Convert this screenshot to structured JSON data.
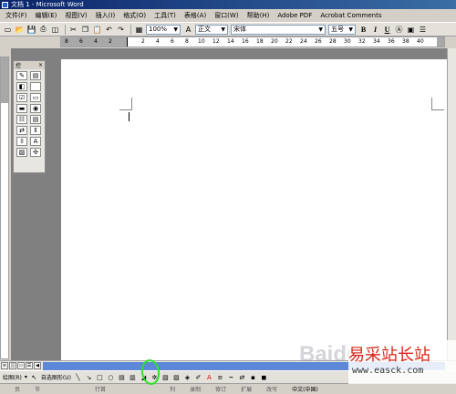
{
  "window": {
    "title": "文档 1 - Microsoft Word"
  },
  "menu": [
    "文件(F)",
    "编辑(E)",
    "视图(V)",
    "插入(I)",
    "格式(O)",
    "工具(T)",
    "表格(A)",
    "窗口(W)",
    "帮助(H)",
    "Adobe PDF",
    "Acrobat Comments"
  ],
  "toolbar": {
    "zoom": "100%",
    "style": "正文",
    "font": "宋体",
    "size": "五号",
    "bold": "B",
    "italic": "I",
    "underline": "U"
  },
  "ruler": {
    "labels": [
      "8",
      "6",
      "4",
      "2",
      "2",
      "4",
      "6",
      "8",
      "10",
      "12",
      "14",
      "16",
      "18",
      "20",
      "22",
      "24",
      "26",
      "28",
      "30",
      "32",
      "34",
      "36",
      "38",
      "40"
    ]
  },
  "control_panel": {
    "title": "控"
  },
  "drawing_toolbar": {
    "draw_label": "绘图(R)",
    "autoshapes_label": "自选图形(U)"
  },
  "status": [
    "页",
    "节",
    "行首",
    "列",
    "录制",
    "修订",
    "扩展",
    "改写",
    "中文(中国)"
  ],
  "watermark": {
    "brand": "易采站长站",
    "url": "www.easck.com",
    "baidu": "Baidu"
  },
  "colors": {
    "highlight": "#2de02d",
    "brand_red": "#d8261b"
  }
}
